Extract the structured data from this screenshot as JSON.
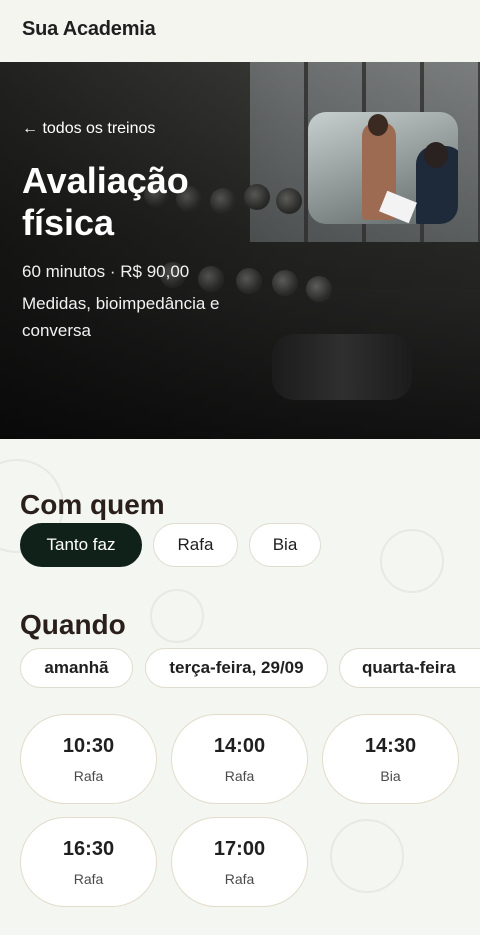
{
  "brand": "Sua Academia",
  "hero": {
    "back_label": "← todos os treinos",
    "title": "Avaliação física",
    "meta": "60 minutos · R$ 90,00",
    "description": "Medidas, bioimpedância e conversa"
  },
  "trainer_section": {
    "heading": "Com quem",
    "options": [
      {
        "label": "Tanto faz",
        "selected": true
      },
      {
        "label": "Rafa",
        "selected": false
      },
      {
        "label": "Bia",
        "selected": false
      }
    ]
  },
  "schedule_section": {
    "heading": "Quando",
    "dates": [
      "amanhã",
      "terça-feira, 29/09",
      "quarta-feira"
    ],
    "slots": [
      {
        "time": "10:30",
        "trainer": "Rafa"
      },
      {
        "time": "14:00",
        "trainer": "Rafa"
      },
      {
        "time": "14:30",
        "trainer": "Bia"
      },
      {
        "time": "16:30",
        "trainer": "Rafa"
      },
      {
        "time": "17:00",
        "trainer": "Rafa"
      }
    ]
  },
  "colors": {
    "accent_dark": "#10211a",
    "page_bg": "#f3f6f1",
    "heading": "#2a1f1a"
  }
}
